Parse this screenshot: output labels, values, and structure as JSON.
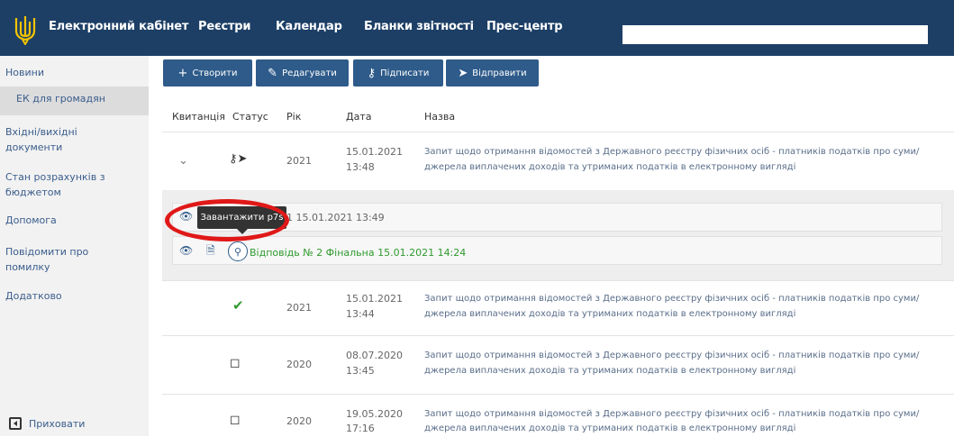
{
  "header": {
    "brand": "Електронний кабінет",
    "nav": [
      "Реєстри",
      "Календар",
      "Бланки звітності",
      "Прес-центр"
    ],
    "search_value": ""
  },
  "sidebar": {
    "items": [
      "Новини",
      "ЕК для громадян",
      "Вхідні/вихідні документи",
      "Стан розрахунків з бюджетом",
      "Допомога",
      "Повідомити про помилку",
      "Додатково"
    ],
    "hide_label": "Приховати"
  },
  "toolbar": {
    "create": "Створити",
    "edit": "Редагувати",
    "sign": "Підписати",
    "send": "Відправити"
  },
  "table": {
    "columns": [
      "Квитанція",
      "Статус",
      "Рік",
      "Дата",
      "Назва"
    ],
    "rows": [
      {
        "year": "2021",
        "date": "15.01.2021",
        "time": "13:48",
        "name1": "Запит щодо отримання відомостей з Державного реєстру фізичних осіб - платників податків про суми/",
        "name2": "джерела виплачених доходів та утриманих податків в електронному вигляді"
      },
      {
        "year": "2021",
        "date": "15.01.2021",
        "time": "13:44",
        "name1": "Запит щодо отримання відомостей з Державного реєстру фізичних осіб - платників податків про суми/",
        "name2": "джерела виплачених доходів та утриманих податків в електронному вигляді"
      },
      {
        "year": "2020",
        "date": "08.07.2020",
        "time": "13:45",
        "name1": "Запит щодо отримання відомостей з Державного реєстру фізичних осіб - платників податків про суми/",
        "name2": "джерела виплачених доходів та утриманих податків в електронному вигляді"
      },
      {
        "year": "2020",
        "date": "19.05.2020",
        "time": "17:16",
        "name1": "Запит щодо отримання відомостей з Державного реєстру фізичних осіб - платників податків про суми/",
        "name2": "джерела виплачених доходів та утриманих податків в електронному вигляді"
      }
    ]
  },
  "expanded": {
    "receipt1_text": "1 15.01.2021 13:49",
    "receipt2_text": "Відповідь № 2 Фінальна 15.01.2021 14:24",
    "tooltip": "Завантажити p7s"
  },
  "colors": {
    "header_bg": "#1d3f66",
    "button_bg": "#2e5b8a",
    "highlight_ring": "#e01818",
    "success": "#2f9a2f"
  }
}
